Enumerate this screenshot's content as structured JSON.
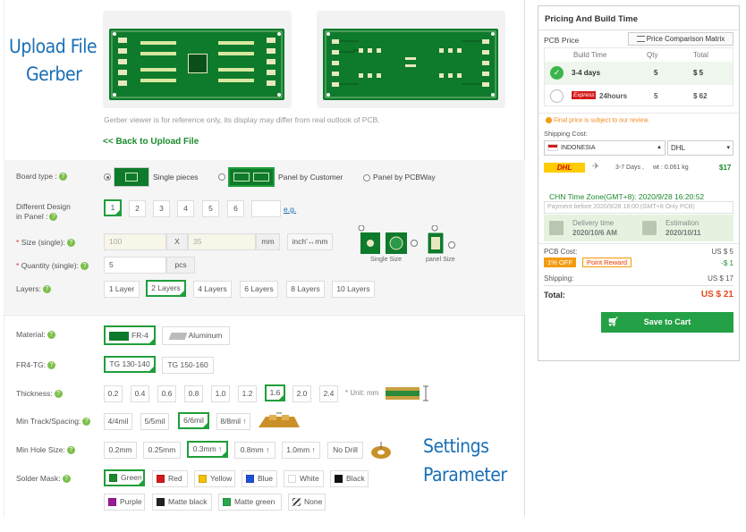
{
  "annotations": {
    "upload_line1": "Upload File",
    "upload_line2": "Gerber",
    "settings_line1": "Settings",
    "settings_line2": "Parameter"
  },
  "gerber": {
    "note": "Gerber viewer is for reference only, its display may differ from real outlook of PCB.",
    "back_link": "<< Back to Upload File"
  },
  "board_type": {
    "label": "Board type :",
    "options": [
      "Single pieces",
      "Panel by Customer",
      "Panel by PCBWay"
    ],
    "selected": "Single pieces"
  },
  "different_design": {
    "label_line1": "Different Design",
    "label_line2": "in Panel :",
    "options": [
      "1",
      "2",
      "3",
      "4",
      "5",
      "6"
    ],
    "selected": "1",
    "eg_link": "e.g."
  },
  "size": {
    "label": "Size (single):",
    "width_placeholder": "100",
    "x_label": "X",
    "height_placeholder": "35",
    "unit": "mm",
    "convert_button": "inch'↔mm",
    "single_size_caption": "Single Size",
    "panel_size_caption": "panel Size"
  },
  "quantity": {
    "label": "Quantity (single):",
    "value": "5",
    "unit": "pcs"
  },
  "layers": {
    "label": "Layers:",
    "options": [
      "1 Layer",
      "2 Layers",
      "4 Layers",
      "6 Layers",
      "8 Layers",
      "10 Layers"
    ],
    "selected": "2 Layers"
  },
  "material": {
    "label": "Material:",
    "options": [
      "FR-4",
      "Aluminum"
    ],
    "selected": "FR-4"
  },
  "fr4_tg": {
    "label": "FR4-TG:",
    "options": [
      "TG 130-140",
      "TG 150-160"
    ],
    "selected": "TG 130-140"
  },
  "thickness": {
    "label": "Thickness:",
    "options": [
      "0.2",
      "0.4",
      "0.6",
      "0.8",
      "1.0",
      "1.2",
      "1.6",
      "2.0",
      "2.4"
    ],
    "selected": "1.6",
    "unit_note": "* Unit: mm"
  },
  "track_spacing": {
    "label": "Min Track/Spacing:",
    "options": [
      "4/4mil",
      "5/5mil",
      "6/6mil",
      "8/8mil ↑"
    ],
    "selected": "6/6mil"
  },
  "hole_size": {
    "label": "Min Hole Size:",
    "options": [
      "0.2mm",
      "0.25mm",
      "0.3mm ↑",
      "0.8mm ↑",
      "1.0mm ↑",
      "No Drill"
    ],
    "selected": "0.3mm ↑"
  },
  "solder_mask": {
    "label": "Solder Mask:",
    "options": [
      {
        "name": "Green",
        "color": "#1a8a2a"
      },
      {
        "name": "Red",
        "color": "#d41a1a"
      },
      {
        "name": "Yellow",
        "color": "#f2c200"
      },
      {
        "name": "Blue",
        "color": "#1f4fd6"
      },
      {
        "name": "White",
        "color": "#ffffff"
      },
      {
        "name": "Black",
        "color": "#111111"
      },
      {
        "name": "Purple",
        "color": "#9b1a9b"
      },
      {
        "name": "Matte black",
        "color": "#222222"
      },
      {
        "name": "Matte green",
        "color": "#2aa84a"
      },
      {
        "name": "None",
        "color": "none"
      }
    ],
    "selected": "Green"
  },
  "sidebar": {
    "title": "Pricing And Build Time",
    "pcb_price_label": "PCB Price",
    "comparison_button": "Price Comparison Matrix",
    "table_headers": [
      "Build Time",
      "Qty",
      "Total"
    ],
    "rows": [
      {
        "time": "3-4 days",
        "qty": "5",
        "total": "$ 5",
        "selected": true
      },
      {
        "badge": "Express",
        "time": "24hours",
        "qty": "5",
        "total": "$ 62",
        "selected": false
      }
    ],
    "final_price_note": "Final price is subject to our review.",
    "shipping_cost_label": "Shipping Cost:",
    "country": "INDONESIA",
    "carrier": "DHL",
    "carrier_logo": "DHL",
    "shipping_days": "3-7 Days ,",
    "shipping_weight": "wt : 0.061 kg",
    "shipping_price": "$17",
    "timezone": "CHN Time Zone(GMT+8): 2020/9/28 16:20:52",
    "payment_before": "Payment before 2020/9/28 18:00 (GMT+8 Only PCB)",
    "delivery_label": "Delivery time",
    "delivery_date": "2020/10/6 AM",
    "estimation_label": "Estimation",
    "estimation_date": "2020/10/11",
    "pcb_cost_label": "PCB Cost:",
    "pcb_cost_value": "US $ 5",
    "discount_badge": "1% OFF",
    "point_reward": "Point Reward",
    "discount_value": "-$ 1",
    "shipping_label": "Shipping:",
    "shipping_value": "US $ 17",
    "total_label": "Total:",
    "total_value": "US $ 21",
    "save_button": "Save to Cart",
    "colors": {
      "accent": "#24a146",
      "price_red": "#e8471c",
      "orange": "#f39c12"
    }
  }
}
